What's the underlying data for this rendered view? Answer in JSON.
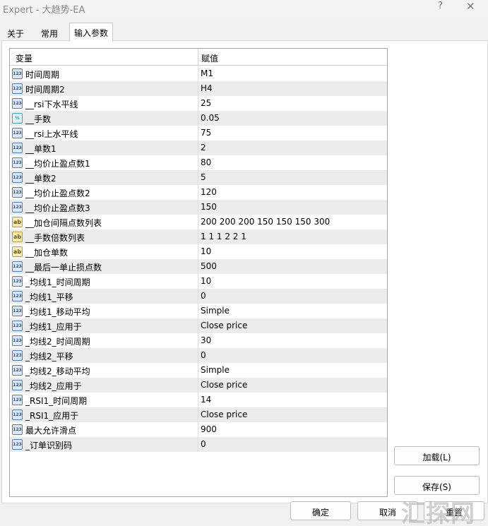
{
  "window": {
    "title": "Expert - 大趋势-EA",
    "help": "?",
    "close": "✕"
  },
  "tabs": [
    {
      "label": "关于",
      "active": false
    },
    {
      "label": "常用",
      "active": false
    },
    {
      "label": "输入参数",
      "active": true
    }
  ],
  "table": {
    "headers": {
      "name": "变量",
      "value": "赋值"
    },
    "rows": [
      {
        "icon": "integer-type-icon",
        "icon_text": "123",
        "name": "时间周期",
        "value": "M1"
      },
      {
        "icon": "integer-type-icon",
        "icon_text": "123",
        "name": "时间周期2",
        "value": "H4"
      },
      {
        "icon": "integer-type-icon",
        "icon_text": "123",
        "name": "__rsi下水平线",
        "value": "25"
      },
      {
        "icon": "double-type-icon",
        "icon_text": "½",
        "name": "__手数",
        "value": "0.05"
      },
      {
        "icon": "integer-type-icon",
        "icon_text": "123",
        "name": "__rsi上水平线",
        "value": "75"
      },
      {
        "icon": "integer-type-icon",
        "icon_text": "123",
        "name": "__单数1",
        "value": "2"
      },
      {
        "icon": "integer-type-icon",
        "icon_text": "123",
        "name": "__均价止盈点数1",
        "value": "80"
      },
      {
        "icon": "integer-type-icon",
        "icon_text": "123",
        "name": "__单数2",
        "value": "5"
      },
      {
        "icon": "integer-type-icon",
        "icon_text": "123",
        "name": "__均价止盈点数2",
        "value": "120"
      },
      {
        "icon": "integer-type-icon",
        "icon_text": "123",
        "name": "__均价止盈点数3",
        "value": "150"
      },
      {
        "icon": "string-type-icon",
        "icon_text": "ab",
        "name": "__加仓间隔点数列表",
        "value": "200 200 200 150 150 150 300"
      },
      {
        "icon": "string-type-icon",
        "icon_text": "ab",
        "name": "__手数倍数列表",
        "value": "1 1 1 2 2 1"
      },
      {
        "icon": "string-type-icon",
        "icon_text": "ab",
        "name": "__加仓单数",
        "value": "10"
      },
      {
        "icon": "integer-type-icon",
        "icon_text": "123",
        "name": "__最后一单止损点数",
        "value": "500"
      },
      {
        "icon": "integer-type-icon",
        "icon_text": "123",
        "name": "_均线1_时间周期",
        "value": "10"
      },
      {
        "icon": "integer-type-icon",
        "icon_text": "123",
        "name": "_均线1_平移",
        "value": "0"
      },
      {
        "icon": "integer-type-icon",
        "icon_text": "123",
        "name": "_均线1_移动平均",
        "value": "Simple"
      },
      {
        "icon": "integer-type-icon",
        "icon_text": "123",
        "name": "_均线1_应用于",
        "value": "Close price"
      },
      {
        "icon": "integer-type-icon",
        "icon_text": "123",
        "name": "_均线2_时间周期",
        "value": "30"
      },
      {
        "icon": "integer-type-icon",
        "icon_text": "123",
        "name": "_均线2_平移",
        "value": "0"
      },
      {
        "icon": "integer-type-icon",
        "icon_text": "123",
        "name": "_均线2_移动平均",
        "value": "Simple"
      },
      {
        "icon": "integer-type-icon",
        "icon_text": "123",
        "name": "_均线2_应用于",
        "value": "Close price"
      },
      {
        "icon": "integer-type-icon",
        "icon_text": "123",
        "name": "_RSI1_时间周期",
        "value": "14"
      },
      {
        "icon": "integer-type-icon",
        "icon_text": "123",
        "name": "_RSI1_应用于",
        "value": "Close price"
      },
      {
        "icon": "integer-type-icon",
        "icon_text": "123",
        "name": "最大允许滑点",
        "value": "900"
      },
      {
        "icon": "integer-type-icon",
        "icon_text": "123",
        "name": "_订单识别码",
        "value": "0"
      }
    ]
  },
  "buttons": {
    "load": "加载(L)",
    "save": "保存(S)",
    "ok": "确定",
    "cancel": "取消",
    "reset": "重置"
  },
  "watermark": "汇探网"
}
